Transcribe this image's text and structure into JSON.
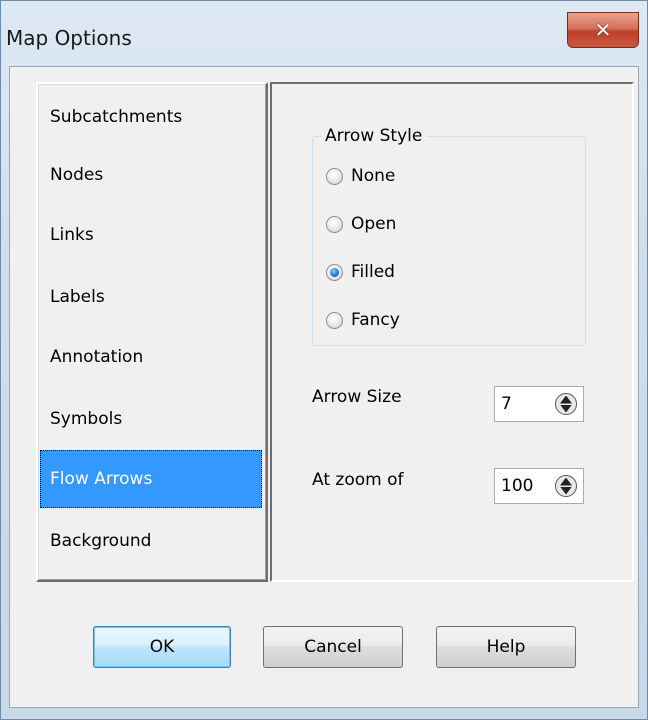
{
  "window": {
    "title": "Map Options",
    "close_glyph": "✕"
  },
  "sidebar": {
    "items": [
      {
        "label": "Subcatchments",
        "selected": false
      },
      {
        "label": "Nodes",
        "selected": false
      },
      {
        "label": "Links",
        "selected": false
      },
      {
        "label": "Labels",
        "selected": false
      },
      {
        "label": "Annotation",
        "selected": false
      },
      {
        "label": "Symbols",
        "selected": false
      },
      {
        "label": "Flow Arrows",
        "selected": true
      },
      {
        "label": "Background",
        "selected": false
      }
    ]
  },
  "arrow_style": {
    "group_label": "Arrow Style",
    "options": [
      {
        "label": "None",
        "checked": false
      },
      {
        "label": "Open",
        "checked": false
      },
      {
        "label": "Filled",
        "checked": true
      },
      {
        "label": "Fancy",
        "checked": false
      }
    ]
  },
  "arrow_size": {
    "label": "Arrow Size",
    "value": "7"
  },
  "zoom": {
    "label": "At zoom of",
    "value": "100"
  },
  "buttons": {
    "ok": "OK",
    "cancel": "Cancel",
    "help": "Help"
  },
  "colors": {
    "selection": "#3399ff",
    "close_button": "#c0402a"
  }
}
